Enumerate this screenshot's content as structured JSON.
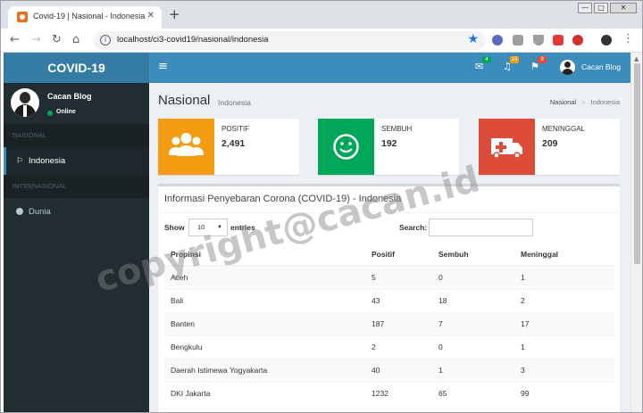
{
  "browser": {
    "tab_title": "Covid-19 | Nasional - Indonesia",
    "tab_close": "✕",
    "new_tab": "+",
    "url": "localhost/ci3-covid19/nasional/indonesia",
    "win_min": "—",
    "win_max": "□",
    "win_close": "✕"
  },
  "app": {
    "logo": "COVID-19",
    "user_name": "Cacan Blog",
    "user_status": "Online",
    "nav_user": "Cacan Blog",
    "badges": {
      "messages": "4",
      "notifications": "10",
      "tasks": "9"
    },
    "accent": "#3c8dbc"
  },
  "sidebar": {
    "header_nasional": "NASIONAL",
    "item_indonesia": "Indonesia",
    "header_internasional": "INTERNASIONAL",
    "item_dunia": "Dunia"
  },
  "page": {
    "title": "Nasional",
    "subtitle": "Indonesia",
    "breadcrumb": [
      "Nasional",
      "Indonesia"
    ]
  },
  "stats": [
    {
      "label": "POSITIF",
      "value": "2,491",
      "color": "#f39c12",
      "icon": "users-icon"
    },
    {
      "label": "SEMBUH",
      "value": "192",
      "color": "#00a65a",
      "icon": "smile-icon"
    },
    {
      "label": "MENINGGAL",
      "value": "209",
      "color": "#dd4b39",
      "icon": "ambulance-icon"
    }
  ],
  "table_box": {
    "title": "Informasi Penyebaran Corona (COVID-19) - Indonesia",
    "show_label": "Show",
    "entries_value": "10",
    "entries_label": "entries",
    "search_label": "Search:",
    "columns": [
      "Propinsi",
      "Positif",
      "Sembuh",
      "Meninggal"
    ],
    "rows": [
      [
        "Aceh",
        "5",
        "0",
        "1"
      ],
      [
        "Bali",
        "43",
        "18",
        "2"
      ],
      [
        "Banten",
        "187",
        "7",
        "17"
      ],
      [
        "Bengkulu",
        "2",
        "0",
        "1"
      ],
      [
        "Daerah Istimewa Yogyakarta",
        "40",
        "1",
        "3"
      ],
      [
        "DKI Jakarta",
        "1232",
        "65",
        "99"
      ]
    ]
  },
  "watermark": "copyright@cacan.id"
}
